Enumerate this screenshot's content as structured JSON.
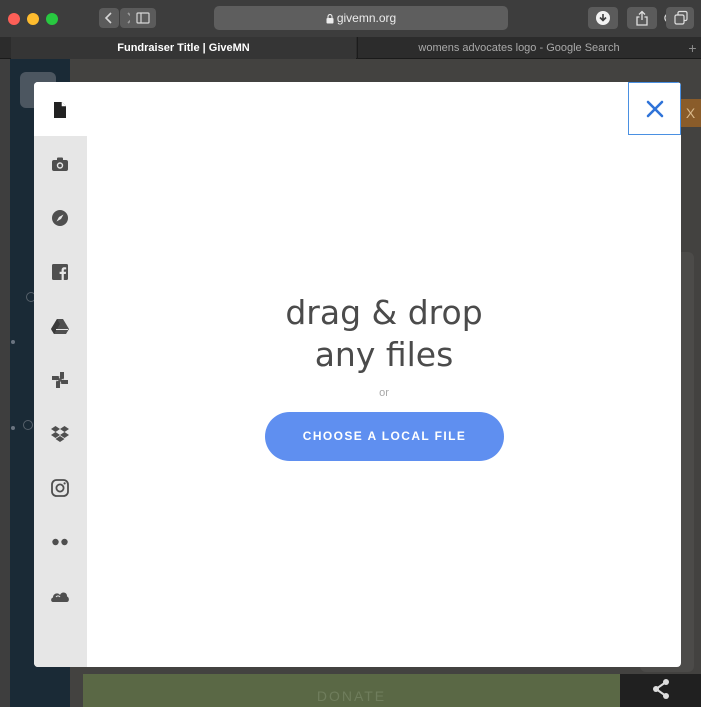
{
  "browser": {
    "address": "givemn.org",
    "tabs": [
      {
        "label": "Fundraiser Title | GiveMN",
        "active": true
      },
      {
        "label": "womens advocates logo - Google Search",
        "active": false
      }
    ],
    "new_tab_label": "+"
  },
  "page": {
    "donate_label": "DONATE",
    "orange_tab_label": "X"
  },
  "picker": {
    "sources": [
      {
        "id": "my-device",
        "icon": "file-icon",
        "active": true
      },
      {
        "id": "webcam",
        "icon": "camera-icon",
        "active": false
      },
      {
        "id": "web-search",
        "icon": "compass-icon",
        "active": false
      },
      {
        "id": "facebook",
        "icon": "facebook-icon",
        "active": false
      },
      {
        "id": "google-drive",
        "icon": "google-drive-icon",
        "active": false
      },
      {
        "id": "google-photos",
        "icon": "google-photos-icon",
        "active": false
      },
      {
        "id": "dropbox",
        "icon": "dropbox-icon",
        "active": false
      },
      {
        "id": "instagram",
        "icon": "instagram-icon",
        "active": false
      },
      {
        "id": "flickr",
        "icon": "flickr-icon",
        "active": false
      },
      {
        "id": "onedrive",
        "icon": "onedrive-icon",
        "active": false
      }
    ],
    "title_line1": "drag & drop",
    "title_line2": "any files",
    "or_label": "or",
    "choose_button_label": "CHOOSE A LOCAL FILE"
  },
  "colors": {
    "accent": "#5f8ff0",
    "close_border": "#4a90e2",
    "close_icon": "#2f73d8",
    "sidebar_bg": "#e6e6e6",
    "icon_gray": "#4f4f4f"
  }
}
